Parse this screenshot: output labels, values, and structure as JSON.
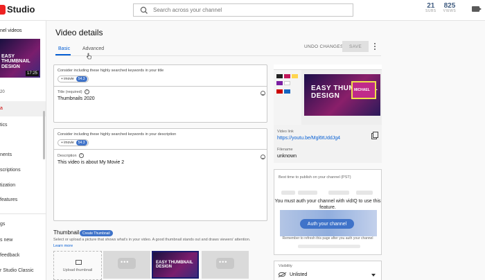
{
  "header": {
    "brand": "Studio",
    "search_placeholder": "Search across your channel",
    "stats": [
      {
        "value": "21",
        "label": "SUBS"
      },
      {
        "value": "825",
        "label": "VIEWS"
      }
    ]
  },
  "sidebar": {
    "title": "nel videos",
    "thumb_text": "EASY THUMBNAIL DESIGN",
    "thumb_duration": "17:25",
    "small_label": "20",
    "items": [
      {
        "label": "a",
        "active": true
      },
      {
        "label": "tics"
      },
      {
        "label": "nents"
      },
      {
        "label": "scriptions"
      },
      {
        "label": "tization"
      },
      {
        "label": "features"
      },
      {
        "label": "gs"
      },
      {
        "label": "s new"
      },
      {
        "label": "feedback"
      },
      {
        "label": "r Studio Classic"
      }
    ]
  },
  "page": {
    "title": "Video details",
    "tabs": [
      {
        "label": "Basic"
      },
      {
        "label": "Advanced"
      }
    ],
    "undo_label": "UNDO CHANGES",
    "save_label": "SAVE"
  },
  "title_field": {
    "keyword_note": "Consider including these highly searched keywords in your title",
    "chip_text": "+ imovie",
    "chip_score": "54.3",
    "label": "Title (required)",
    "value": "Thumbnails 2020"
  },
  "description_field": {
    "keyword_note": "Consider including these highly searched keywords in your description",
    "chip_text": "+ imovie",
    "chip_score": "54.3",
    "label": "Description",
    "value": "This video is about My Movie 2"
  },
  "thumbnail": {
    "heading": "Thumbnail",
    "create_label": "Create Thumbnail",
    "description": "Select or upload a picture that shows what's in your video. A good thumbnail stands out and draws viewers' attention.",
    "learn_more": "Learn more",
    "upload_label": "Upload thumbnail",
    "selected_text": "EASY THUMBNAIL DESIGN"
  },
  "preview": {
    "art_text": "EASY THUMBNAIL DESIGN",
    "card_text": "MICHAEL",
    "video_link_label": "Video link",
    "video_link": "https://youtu.be/Mgl6tUddJg4",
    "filename_label": "Filename",
    "filename": "unknown"
  },
  "best_time": {
    "title": "Best time to publish on your channel (PST)",
    "message": "You must auth your channel with vidIQ to use this feature.",
    "button_label": "Auth your channel",
    "note": "Remember to refresh this page after you auth your channel"
  },
  "visibility": {
    "label": "Visibility",
    "value": "Unlisted"
  }
}
